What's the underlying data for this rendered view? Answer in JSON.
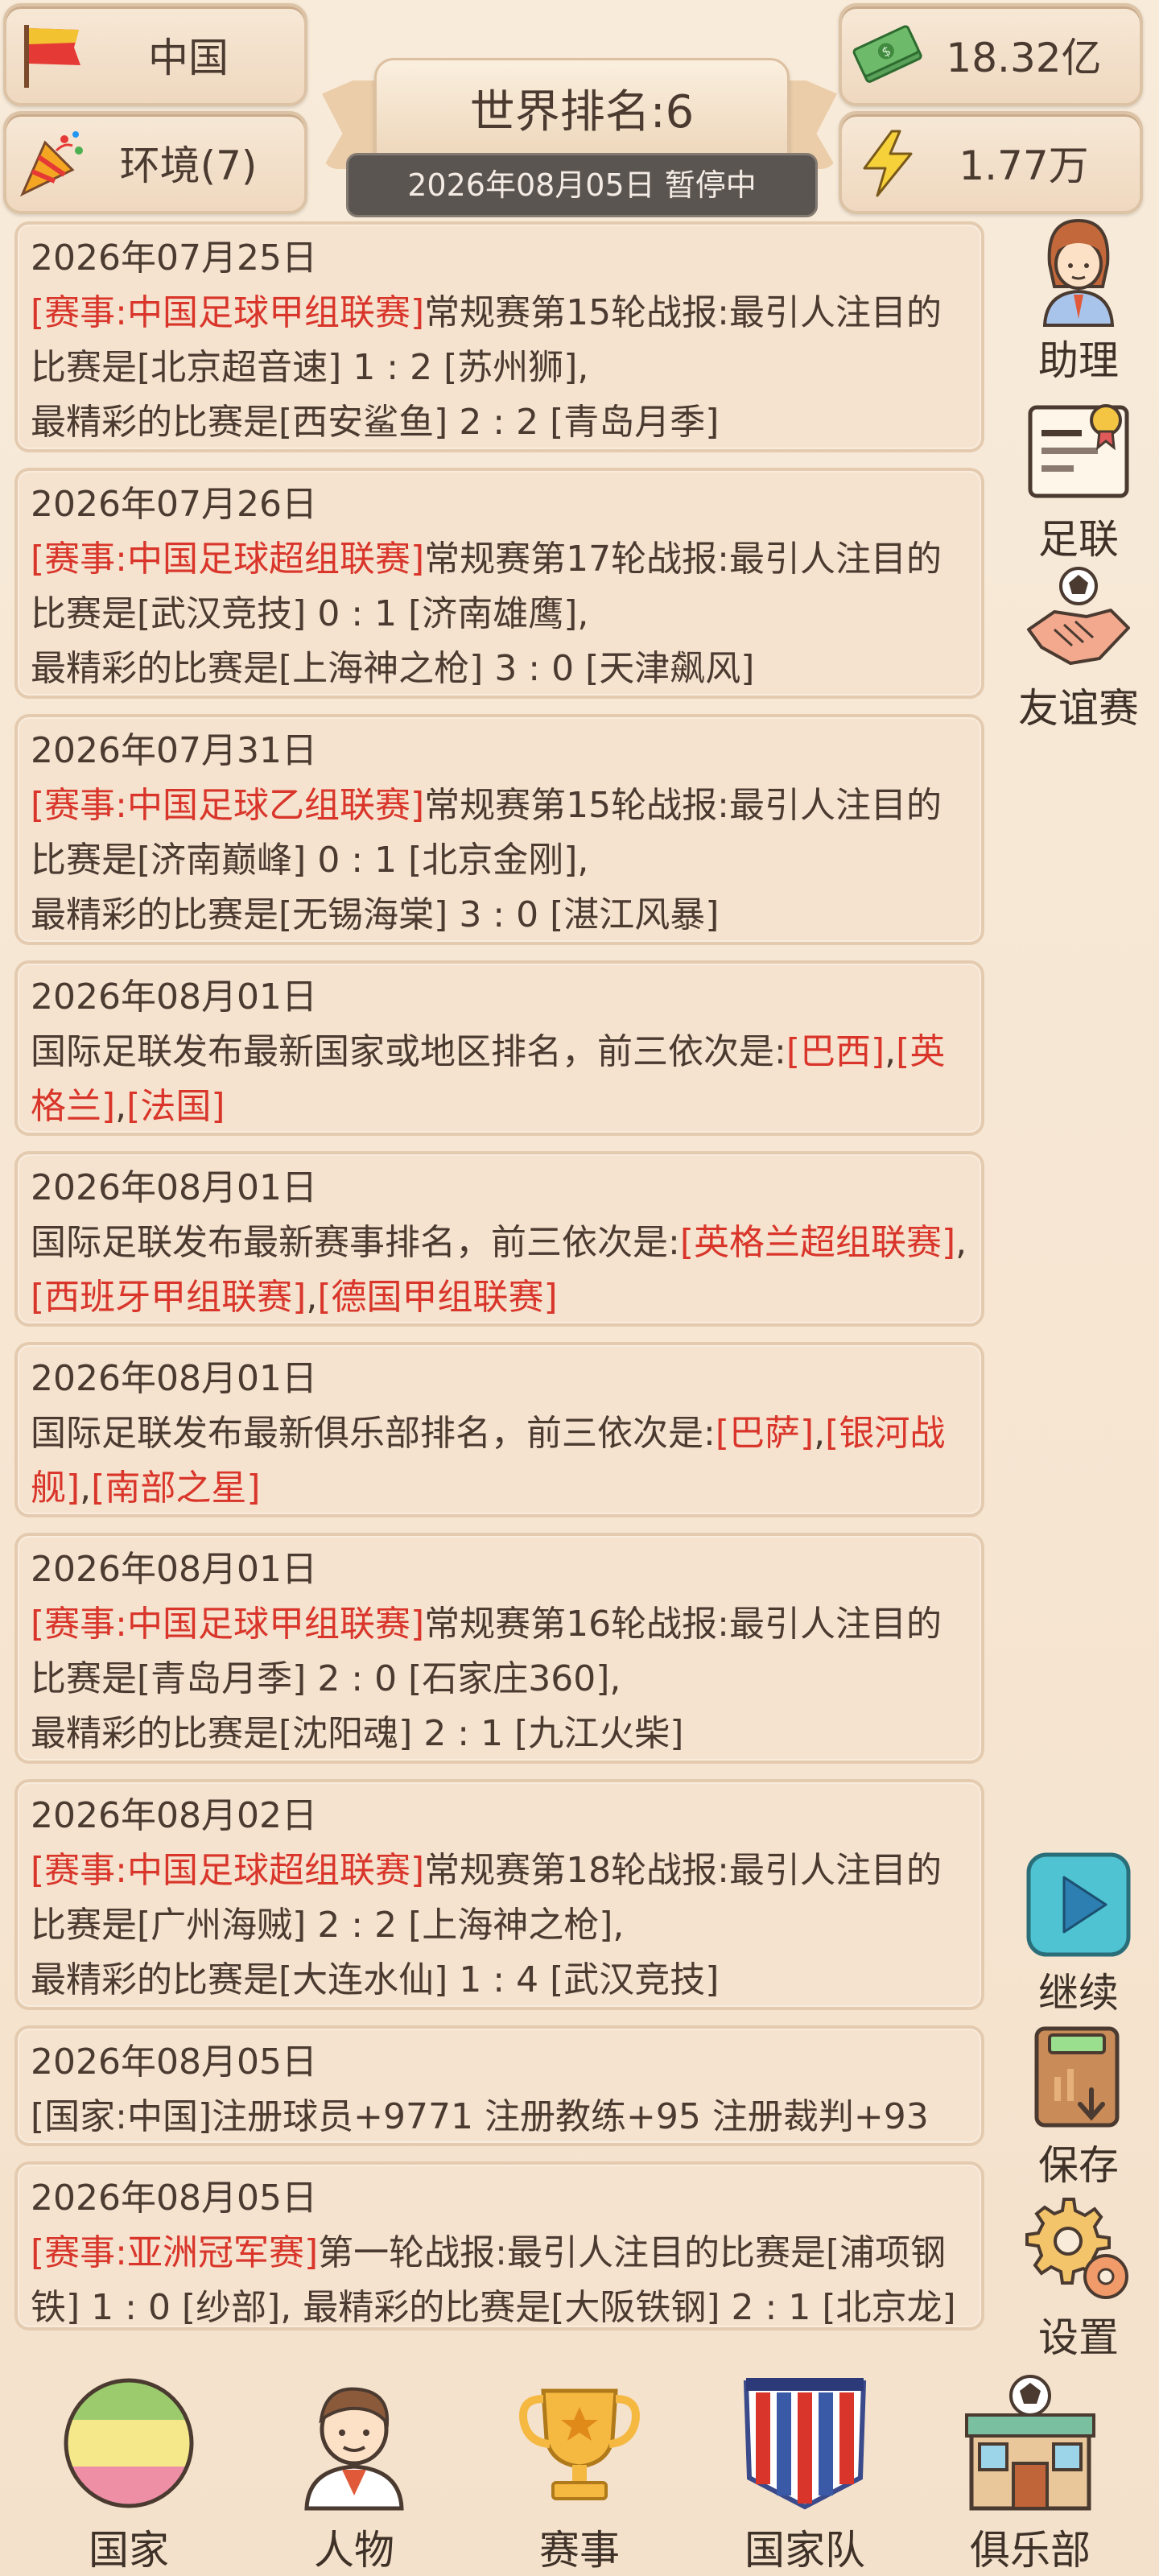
{
  "header": {
    "country": "中国",
    "environment": "环境(7)",
    "money": "18.32亿",
    "energy": "1.77万",
    "world_rank": "世界排名:6",
    "status_date": "2026年08月05日 暂停中"
  },
  "feed": [
    {
      "date": "2026年07月25日",
      "parts": [
        {
          "t": "[赛事:中国足球甲组联赛]",
          "red": true
        },
        {
          "t": "常规赛第15轮战报:最引人注目的比赛是[北京超音速] 1 : 2 [苏州狮],",
          "red": false
        },
        {
          "t": "\n最精彩的比赛是[西安鲨鱼] 2 : 2 [青岛月季]",
          "red": false
        }
      ]
    },
    {
      "date": "2026年07月26日",
      "parts": [
        {
          "t": "[赛事:中国足球超组联赛]",
          "red": true
        },
        {
          "t": "常规赛第17轮战报:最引人注目的比赛是[武汉竞技] 0 : 1 [济南雄鹰],",
          "red": false
        },
        {
          "t": "\n最精彩的比赛是[上海神之枪] 3 : 0 [天津飙风]",
          "red": false
        }
      ]
    },
    {
      "date": "2026年07月31日",
      "parts": [
        {
          "t": "[赛事:中国足球乙组联赛]",
          "red": true
        },
        {
          "t": "常规赛第15轮战报:最引人注目的比赛是[济南巅峰] 0 : 1 [北京金刚],",
          "red": false
        },
        {
          "t": "\n最精彩的比赛是[无锡海棠] 3 : 0 [湛江风暴]",
          "red": false
        }
      ]
    },
    {
      "date": "2026年08月01日",
      "parts": [
        {
          "t": "国际足联发布最新国家或地区排名，前三依次是:",
          "red": false
        },
        {
          "t": "[巴西]",
          "red": true
        },
        {
          "t": ",",
          "red": false
        },
        {
          "t": "[英格兰]",
          "red": true
        },
        {
          "t": ",",
          "red": false
        },
        {
          "t": "[法国]",
          "red": true
        }
      ]
    },
    {
      "date": "2026年08月01日",
      "parts": [
        {
          "t": "国际足联发布最新赛事排名，前三依次是:",
          "red": false
        },
        {
          "t": "[英格兰超组联赛]",
          "red": true
        },
        {
          "t": ",",
          "red": false
        },
        {
          "t": "[西班牙甲组联赛]",
          "red": true
        },
        {
          "t": ",",
          "red": false
        },
        {
          "t": "[德国甲组联赛]",
          "red": true
        }
      ]
    },
    {
      "date": "2026年08月01日",
      "parts": [
        {
          "t": "国际足联发布最新俱乐部排名，前三依次是:",
          "red": false
        },
        {
          "t": "[巴萨]",
          "red": true
        },
        {
          "t": ",",
          "red": false
        },
        {
          "t": "[银河战舰]",
          "red": true
        },
        {
          "t": ",",
          "red": false
        },
        {
          "t": "[南部之星]",
          "red": true
        }
      ]
    },
    {
      "date": "2026年08月01日",
      "parts": [
        {
          "t": "[赛事:中国足球甲组联赛]",
          "red": true
        },
        {
          "t": "常规赛第16轮战报:最引人注目的比赛是[青岛月季] 2 : 0 [石家庄360],",
          "red": false
        },
        {
          "t": "\n最精彩的比赛是[沈阳魂] 2 : 1 [九江火柴]",
          "red": false
        }
      ]
    },
    {
      "date": "2026年08月02日",
      "parts": [
        {
          "t": "[赛事:中国足球超组联赛]",
          "red": true
        },
        {
          "t": "常规赛第18轮战报:最引人注目的比赛是[广州海贼] 2 : 2 [上海神之枪],",
          "red": false
        },
        {
          "t": "\n最精彩的比赛是[大连水仙] 1 : 4 [武汉竞技]",
          "red": false
        }
      ]
    },
    {
      "date": "2026年08月05日",
      "parts": [
        {
          "t": "[国家:中国]注册球员+9771 注册教练+95 注册裁判+93",
          "red": false
        }
      ]
    },
    {
      "date": "2026年08月05日",
      "parts": [
        {
          "t": "[赛事:亚洲冠军赛]",
          "red": true
        },
        {
          "t": "第一轮战报:最引人注目的比赛是[浦项钢铁] 1 : 0 [纱部], 最精彩的比赛是[大阪铁钢] 2 : 1 [北京龙]",
          "red": false
        }
      ]
    }
  ],
  "side": {
    "assistant": "助理",
    "football_assoc": "足联",
    "friendly": "友谊赛",
    "continue": "继续",
    "save": "保存",
    "settings": "设置"
  },
  "nav": {
    "country": "国家",
    "people": "人物",
    "events": "赛事",
    "national_team": "国家队",
    "club": "俱乐部"
  },
  "colors": {
    "highlight_red": "#d9352a",
    "background": "#f6e6d2",
    "card_border": "#e4cbb0",
    "continue_teal": "#4fc3d1"
  }
}
